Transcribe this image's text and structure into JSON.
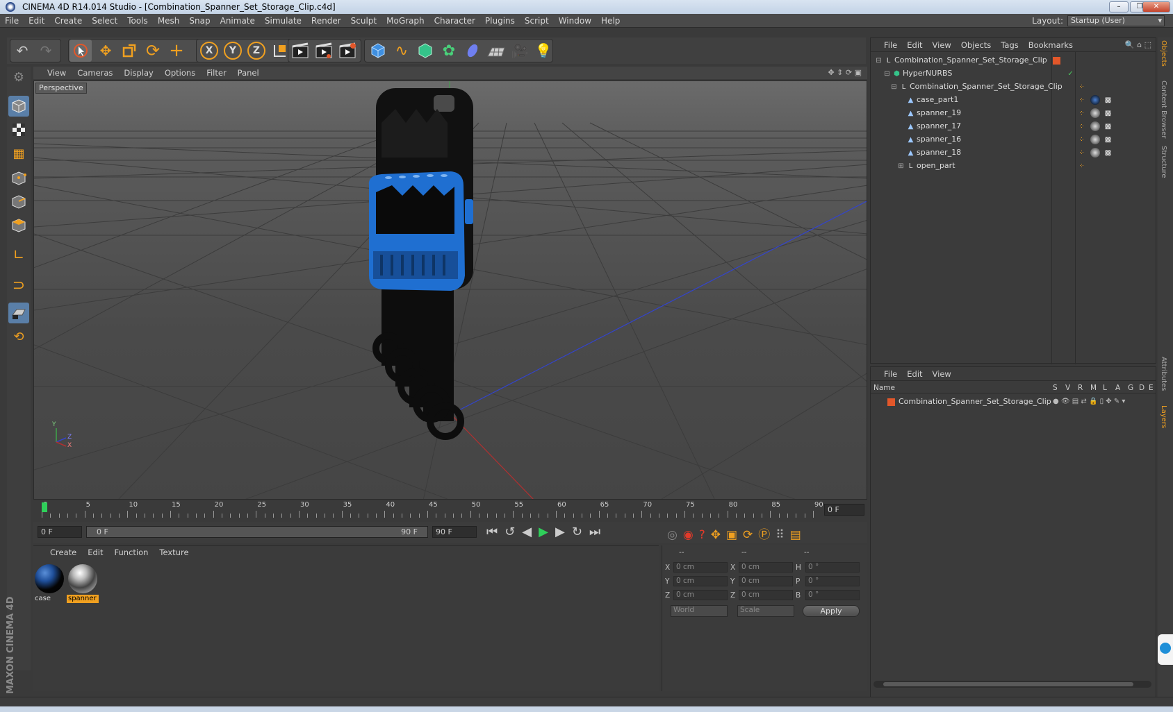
{
  "window": {
    "title": "CINEMA 4D R14.014 Studio - [Combination_Spanner_Set_Storage_Clip.c4d]",
    "minimize_icon": "minimize-icon",
    "maximize_icon": "maximize-icon",
    "close_icon": "close-icon"
  },
  "menubar": {
    "items": [
      "File",
      "Edit",
      "Create",
      "Select",
      "Tools",
      "Mesh",
      "Snap",
      "Animate",
      "Simulate",
      "Render",
      "Sculpt",
      "MoGraph",
      "Character",
      "Plugins",
      "Script",
      "Window",
      "Help"
    ],
    "layout_label": "Layout:",
    "layout_value": "Startup (User)"
  },
  "toolbar": {
    "icons": [
      "undo-icon",
      "redo-icon",
      "live-selection-icon",
      "move-icon",
      "scale-icon",
      "rotate-icon",
      "add-icon",
      "x-axis-icon",
      "y-axis-icon",
      "z-axis-icon",
      "coordinate-system-icon",
      "render-view-icon",
      "render-picture-viewer-icon",
      "edit-render-settings-icon",
      "cube-icon",
      "spline-icon",
      "nurbs-icon",
      "array-icon",
      "deformer-icon",
      "floor-icon",
      "camera-icon",
      "light-icon"
    ],
    "axis_x": "X",
    "axis_y": "Y",
    "axis_z": "Z"
  },
  "viewport": {
    "menu": [
      "View",
      "Cameras",
      "Display",
      "Options",
      "Filter",
      "Panel"
    ],
    "label": "Perspective",
    "axis_y": "Y",
    "axis_z": "Z",
    "axis_x": "X",
    "accent_blue": "#1f6fd1"
  },
  "timeline": {
    "ticks": [
      "0",
      "5",
      "10",
      "15",
      "20",
      "25",
      "30",
      "35",
      "40",
      "45",
      "50",
      "55",
      "60",
      "65",
      "70",
      "75",
      "80",
      "85",
      "90"
    ],
    "current_frame": "0 F",
    "start_field": "0 F",
    "range_start": "0 F",
    "range_end": "90 F",
    "end_field": "90 F"
  },
  "materials": {
    "menu": [
      "Create",
      "Edit",
      "Function",
      "Texture"
    ],
    "items": [
      {
        "name": "case"
      },
      {
        "name": "spanner"
      }
    ]
  },
  "coordinates": {
    "headers": [
      "--",
      "--",
      "--"
    ],
    "rows": [
      {
        "l1": "X",
        "v1": "0 cm",
        "l2": "X",
        "v2": "0 cm",
        "l3": "H",
        "v3": "0 °"
      },
      {
        "l1": "Y",
        "v1": "0 cm",
        "l2": "Y",
        "v2": "0 cm",
        "l3": "P",
        "v3": "0 °"
      },
      {
        "l1": "Z",
        "v1": "0 cm",
        "l2": "Z",
        "v2": "0 cm",
        "l3": "B",
        "v3": "0 °"
      }
    ],
    "world": "World",
    "scale": "Scale",
    "apply": "Apply"
  },
  "objects": {
    "menu": [
      "File",
      "Edit",
      "View",
      "Objects",
      "Tags",
      "Bookmarks"
    ],
    "tree": [
      {
        "name": "Combination_Spanner_Set_Storage_Clip",
        "depth": 0
      },
      {
        "name": "HyperNURBS",
        "depth": 1
      },
      {
        "name": "Combination_Spanner_Set_Storage_Clip",
        "depth": 2
      },
      {
        "name": "case_part1",
        "depth": 3
      },
      {
        "name": "spanner_19",
        "depth": 3
      },
      {
        "name": "spanner_17",
        "depth": 3
      },
      {
        "name": "spanner_16",
        "depth": 3
      },
      {
        "name": "spanner_18",
        "depth": 3
      },
      {
        "name": "open_part",
        "depth": 3
      }
    ]
  },
  "layers": {
    "menu": [
      "File",
      "Edit",
      "View"
    ],
    "columns": [
      "Name",
      "S",
      "V",
      "R",
      "M",
      "L",
      "A",
      "G",
      "D",
      "E"
    ],
    "rows": [
      "Combination_Spanner_Set_Storage_Clip"
    ]
  },
  "right_tabs": [
    "Objects",
    "Content Browser",
    "Structure",
    "Attributes",
    "Layers"
  ],
  "branding": "MAXON CINEMA 4D"
}
